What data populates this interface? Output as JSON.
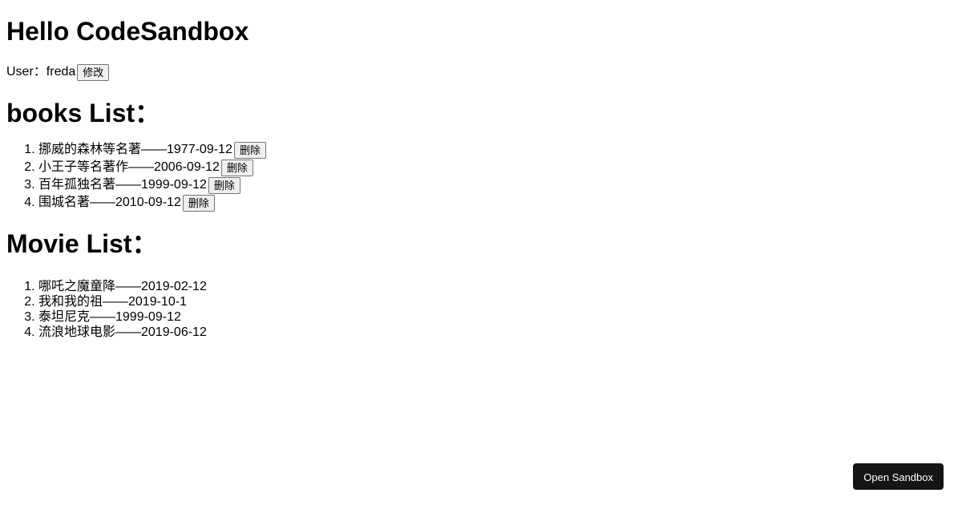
{
  "header": {
    "title": "Hello CodeSandbox"
  },
  "user": {
    "label": "User：",
    "name": "freda",
    "button_label": "修改"
  },
  "books": {
    "title": "books List：",
    "items": [
      {
        "text": "挪威的森林等名著——1977-09-12",
        "button_label": "删除"
      },
      {
        "text": "小王子等名著作——2006-09-12",
        "button_label": "删除"
      },
      {
        "text": "百年孤独名著——1999-09-12",
        "button_label": "删除"
      },
      {
        "text": "围城名著——2010-09-12",
        "button_label": "删除"
      }
    ]
  },
  "movies": {
    "title": "Movie List：",
    "items": [
      {
        "text": "哪吒之魔童降——2019-02-12"
      },
      {
        "text": "我和我的祖——2019-10-1"
      },
      {
        "text": "泰坦尼克——1999-09-12"
      },
      {
        "text": "流浪地球电影——2019-06-12"
      }
    ]
  },
  "footer": {
    "open_button_label": "Open Sandbox"
  },
  "colors": {
    "open_button_bg": "#151515",
    "button_bg": "#efefef"
  }
}
